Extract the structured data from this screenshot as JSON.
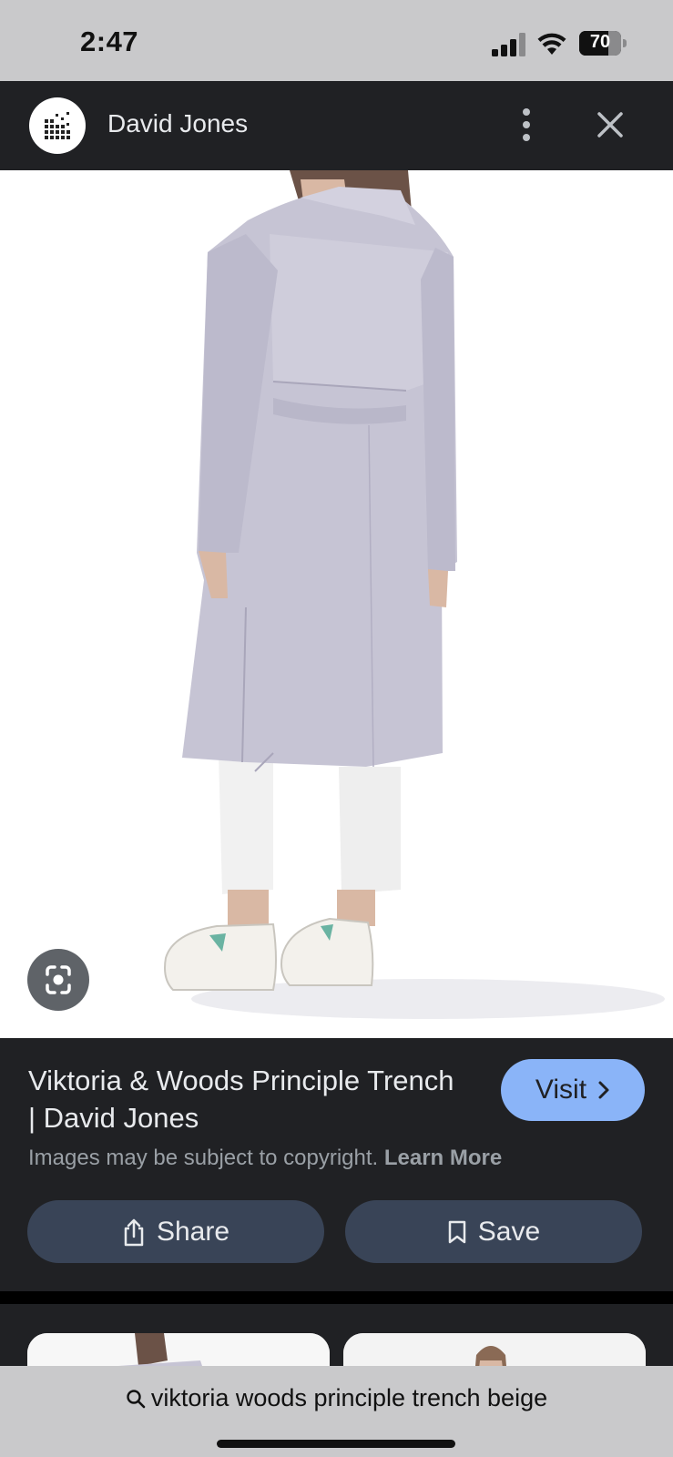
{
  "status": {
    "time": "2:47",
    "battery": "70",
    "battery_level": 0.7
  },
  "header": {
    "site_name": "David Jones",
    "logo_icon": "david-jones-logo",
    "more_icon": "more-vert-icon",
    "close_icon": "close-icon"
  },
  "image": {
    "lens_icon": "google-lens-icon"
  },
  "result": {
    "title": "Viktoria & Woods Principle Trench | David Jones",
    "visit_label": "Visit",
    "copyright_text": "Images may be subject to copyright.",
    "learn_more": "Learn More",
    "share_label": "Share",
    "save_label": "Save"
  },
  "search": {
    "query": "viktoria woods principle trench beige",
    "icon": "search-icon"
  },
  "colors": {
    "panel_bg": "#202124",
    "visit_button": "#8ab4f8",
    "pill_button": "#394457",
    "status_bar": "#c9c9cb",
    "coat": "#c6c4d4"
  }
}
